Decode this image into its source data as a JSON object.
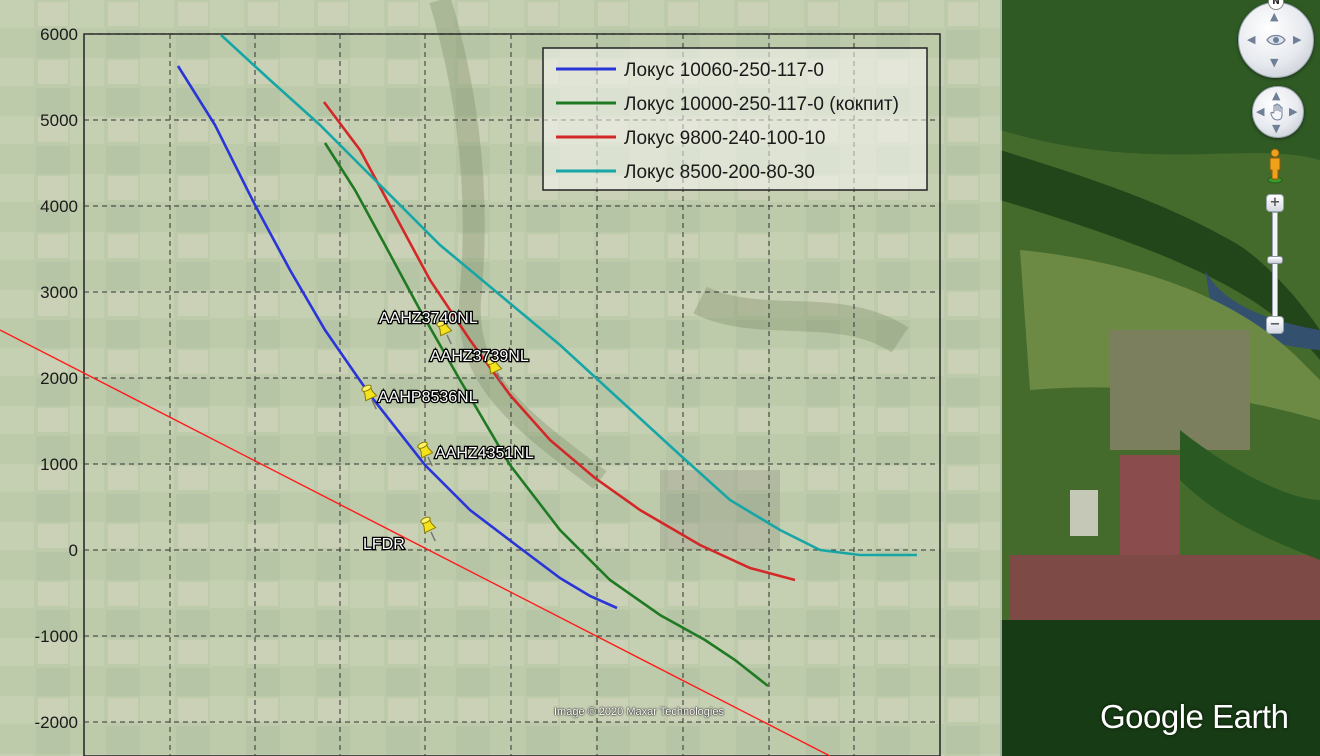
{
  "overlay": {
    "y_axis_ticks": [
      "6000",
      "5000",
      "4000",
      "3000",
      "2000",
      "1000",
      "0",
      "-1000",
      "-2000"
    ],
    "legend": [
      {
        "label": "Локус 10060-250-117-0",
        "color": "#2a35d8"
      },
      {
        "label": "Локус 10000-250-117-0 (кокпит)",
        "color": "#1f7a23"
      },
      {
        "label": "Локус 9800-240-100-10",
        "color": "#d42828"
      },
      {
        "label": "Локус 8500-200-80-30",
        "color": "#17a6a6"
      }
    ],
    "reference_line_color": "#ff1a1a"
  },
  "placemarks": [
    {
      "label": "AAHZ3740NL",
      "icon": "yellow-pushpin-icon"
    },
    {
      "label": "AAHZ3739NL",
      "icon": "yellow-pushpin-icon"
    },
    {
      "label": "AAHP8536NL",
      "icon": "yellow-pushpin-icon"
    },
    {
      "label": "AAHZ4351NL",
      "icon": "yellow-pushpin-icon"
    },
    {
      "label": "LFDR",
      "icon": "yellow-pushpin-icon"
    }
  ],
  "controls": {
    "north_label": "N",
    "zoom_in_label": "+",
    "zoom_out_label": "−",
    "look_icon": "eye-icon",
    "move_icon": "hand-icon",
    "street_view_icon": "pegman-icon"
  },
  "attribution": "Image © 2020 Maxar Technologies",
  "brand": "Google Earth"
}
